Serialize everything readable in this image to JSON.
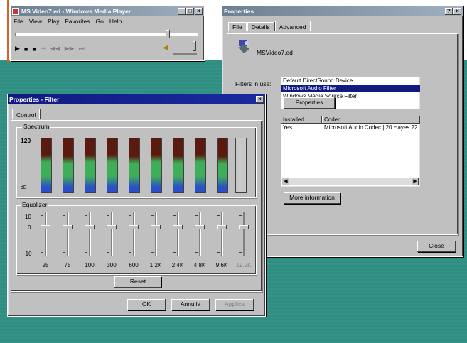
{
  "player": {
    "title": "MS Video7.ed - Windows Media Player",
    "menu": [
      "File",
      "View",
      "Play",
      "Favorites",
      "Go",
      "Help"
    ]
  },
  "properties": {
    "title": "Properties",
    "tabs": [
      "File",
      "Details",
      "Advanced"
    ],
    "file_name": "MSVideo7.ed",
    "filters_label": "Filters in use:",
    "filters": [
      "Default DirectSound Device",
      "Microsoft Audio Filter",
      "Windows Media Source Filter"
    ],
    "properties_button": "Properties",
    "codec_headers": [
      "Installed",
      "Codec"
    ],
    "codec_row": [
      "Yes",
      "Microsoft Audio Codec | 20 Hayes 22"
    ],
    "more_info_button": "More information",
    "close_button": "Close"
  },
  "filter_props": {
    "title": "Properties - Filter",
    "tab": "Control",
    "spectrum_label": "Spectrum",
    "spectrum_top": "120",
    "spectrum_bottom": "dB",
    "equalizer_label": "Equalizer",
    "eq_top": "10",
    "eq_mid": "0",
    "eq_bottom": "-10",
    "bands": [
      {
        "label": "25",
        "level": 0.78
      },
      {
        "label": "75",
        "level": 0.75
      },
      {
        "label": "100",
        "level": 0.78
      },
      {
        "label": "300",
        "level": 0.78
      },
      {
        "label": "600",
        "level": 0.75
      },
      {
        "label": "1.2K",
        "level": 0.78
      },
      {
        "label": "2.4K",
        "level": 0.76
      },
      {
        "label": "4.8K",
        "level": 0.78
      },
      {
        "label": "9.6K",
        "level": 0.75
      },
      {
        "label": "19.2K",
        "level": 0.0
      }
    ],
    "reset_button": "Reset",
    "ok_button": "OK",
    "cancel_button": "Annulla",
    "apply_button": "Applica"
  },
  "colors": {
    "spectrum_top": "#5a1a10",
    "spectrum_mid": "#3fae58",
    "spectrum_low": "#2a4fc8",
    "teal_bg": "#2e8f82",
    "accent": "#d8602c"
  }
}
